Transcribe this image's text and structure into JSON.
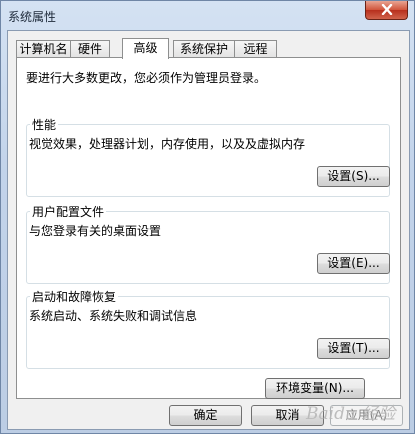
{
  "window": {
    "title": "系统属性"
  },
  "tabs": [
    {
      "label": "计算机名"
    },
    {
      "label": "硬件"
    },
    {
      "label": "高级",
      "selected": true
    },
    {
      "label": "系统保护"
    },
    {
      "label": "远程"
    }
  ],
  "advanced": {
    "intro": "要进行大多数更改，您必须作为管理员登录。",
    "performance": {
      "title": "性能",
      "description": "视觉效果，处理器计划，内存使用，以及及虚拟内存",
      "button": "设置(S)..."
    },
    "user_profiles": {
      "title": "用户配置文件",
      "description": "与您登录有关的桌面设置",
      "button": "设置(E)..."
    },
    "startup_recovery": {
      "title": "启动和故障恢复",
      "description": "系统启动、系统失败和调试信息",
      "button": "设置(T)..."
    },
    "env_button": "环境变量(N)..."
  },
  "footer": {
    "ok": "确定",
    "cancel": "取消",
    "apply": "应用(A)"
  },
  "watermark": "Baidu 经验"
}
